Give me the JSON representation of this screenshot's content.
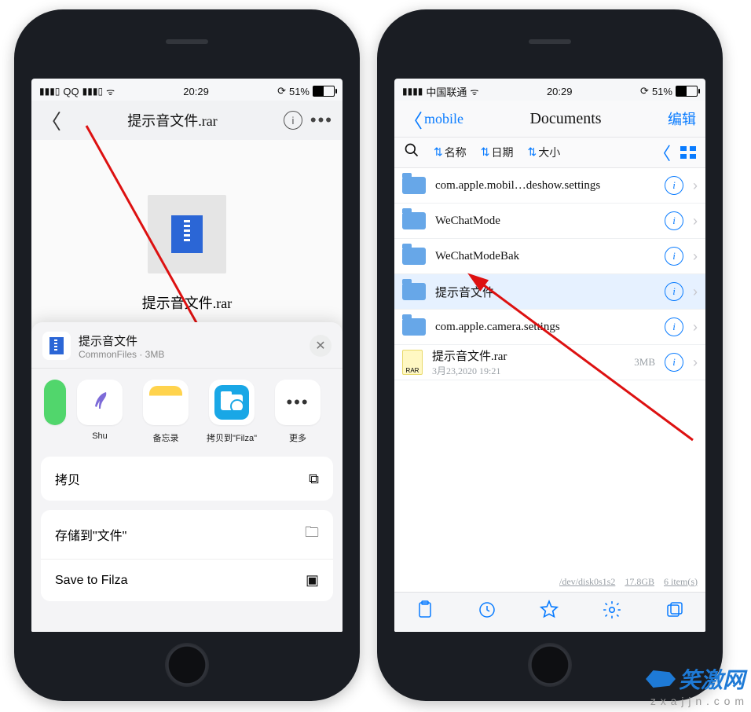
{
  "left": {
    "status": {
      "carrier": "QQ",
      "time": "20:29",
      "battery_text": "51%"
    },
    "nav": {
      "title": "提示音文件.rar"
    },
    "preview": {
      "filename": "提示音文件.rar"
    },
    "share": {
      "file_title": "提示音文件",
      "file_meta": "CommonFiles · 3MB",
      "activities": [
        {
          "name": "shu",
          "label": "Shu"
        },
        {
          "name": "notes",
          "label": "备忘录"
        },
        {
          "name": "filza",
          "label": "拷贝到\"Filza\""
        },
        {
          "name": "more",
          "label": "更多"
        }
      ],
      "actions": {
        "copy": "拷贝",
        "save_files": "存储到\"文件\"",
        "save_filza": "Save to Filza"
      }
    }
  },
  "right": {
    "status": {
      "carrier": "中国联通",
      "time": "20:29",
      "battery_text": "51%"
    },
    "nav": {
      "back": "mobile",
      "title": "Documents",
      "edit": "编辑"
    },
    "toolbar": {
      "sort_name": "名称",
      "sort_date": "日期",
      "sort_size": "大小"
    },
    "items": [
      {
        "type": "folder",
        "name": "com.apple.mobil…deshow.settings"
      },
      {
        "type": "folder",
        "name": "WeChatMode"
      },
      {
        "type": "folder",
        "name": "WeChatModeBak"
      },
      {
        "type": "folder",
        "name": "提示音文件",
        "selected": true
      },
      {
        "type": "folder",
        "name": "com.apple.camera.settings"
      },
      {
        "type": "file",
        "name": "提示音文件.rar",
        "sub": "3月23,2020 19:21",
        "meta": "3MB"
      }
    ],
    "footer": {
      "disk": "/dev/disk0s1s2",
      "space": "17.8GB",
      "count": "6 item(s)"
    }
  },
  "watermark": {
    "brand": "笑激网",
    "sub": "z x a j j n . c o m"
  }
}
